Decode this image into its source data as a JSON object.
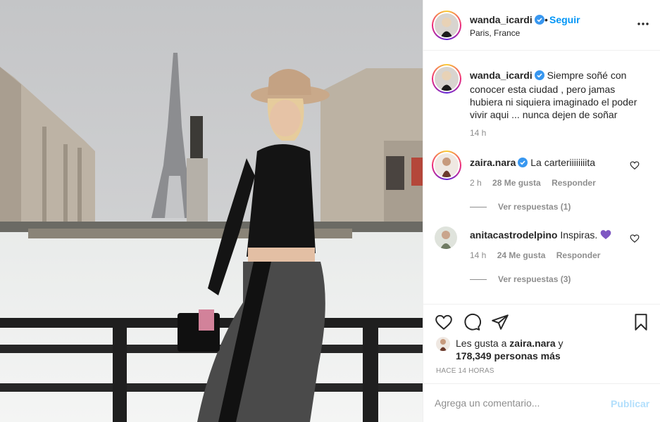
{
  "post": {
    "header": {
      "username": "wanda_icardi",
      "follow_label": "Seguir",
      "location": "Paris, France",
      "more_icon": "more-horizontal-icon"
    },
    "caption": {
      "username": "wanda_icardi",
      "text": "Siempre soñé con conocer esta ciudad , pero jamas hubiera ni siquiera imaginado el poder vivir aqui ... nunca dejen de soñar",
      "time": "14 h"
    },
    "comments": [
      {
        "username": "zaira.nara",
        "verified": true,
        "text": "La carteriiiiiiiita",
        "time": "2 h",
        "likes": "28 Me gusta",
        "reply_label": "Responder",
        "view_replies": "Ver respuestas (1)"
      },
      {
        "username": "anitacastrodelpino",
        "verified": false,
        "text": "Inspiras.",
        "emoji": "purple-heart",
        "time": "14 h",
        "likes": "24 Me gusta",
        "reply_label": "Responder",
        "view_replies": "Ver respuestas (3)"
      }
    ],
    "actions": {
      "like_icon": "heart-icon",
      "comment_icon": "comment-icon",
      "share_icon": "share-icon",
      "save_icon": "bookmark-icon"
    },
    "likes": {
      "prefix": "Les gusta a ",
      "liked_by": "zaira.nara",
      "conjunction": " y",
      "count_text": "178,349 personas más"
    },
    "time_ago": "HACE 14 HORAS",
    "add_comment": {
      "placeholder": "Agrega un comentario...",
      "publish_label": "Publicar"
    },
    "colors": {
      "link_blue": "#0095f6",
      "publish_disabled": "#b2dffc",
      "muted_text": "#8e8e8e",
      "verified_badge": "#3897f0",
      "purple_heart": "#7e57c2"
    }
  }
}
